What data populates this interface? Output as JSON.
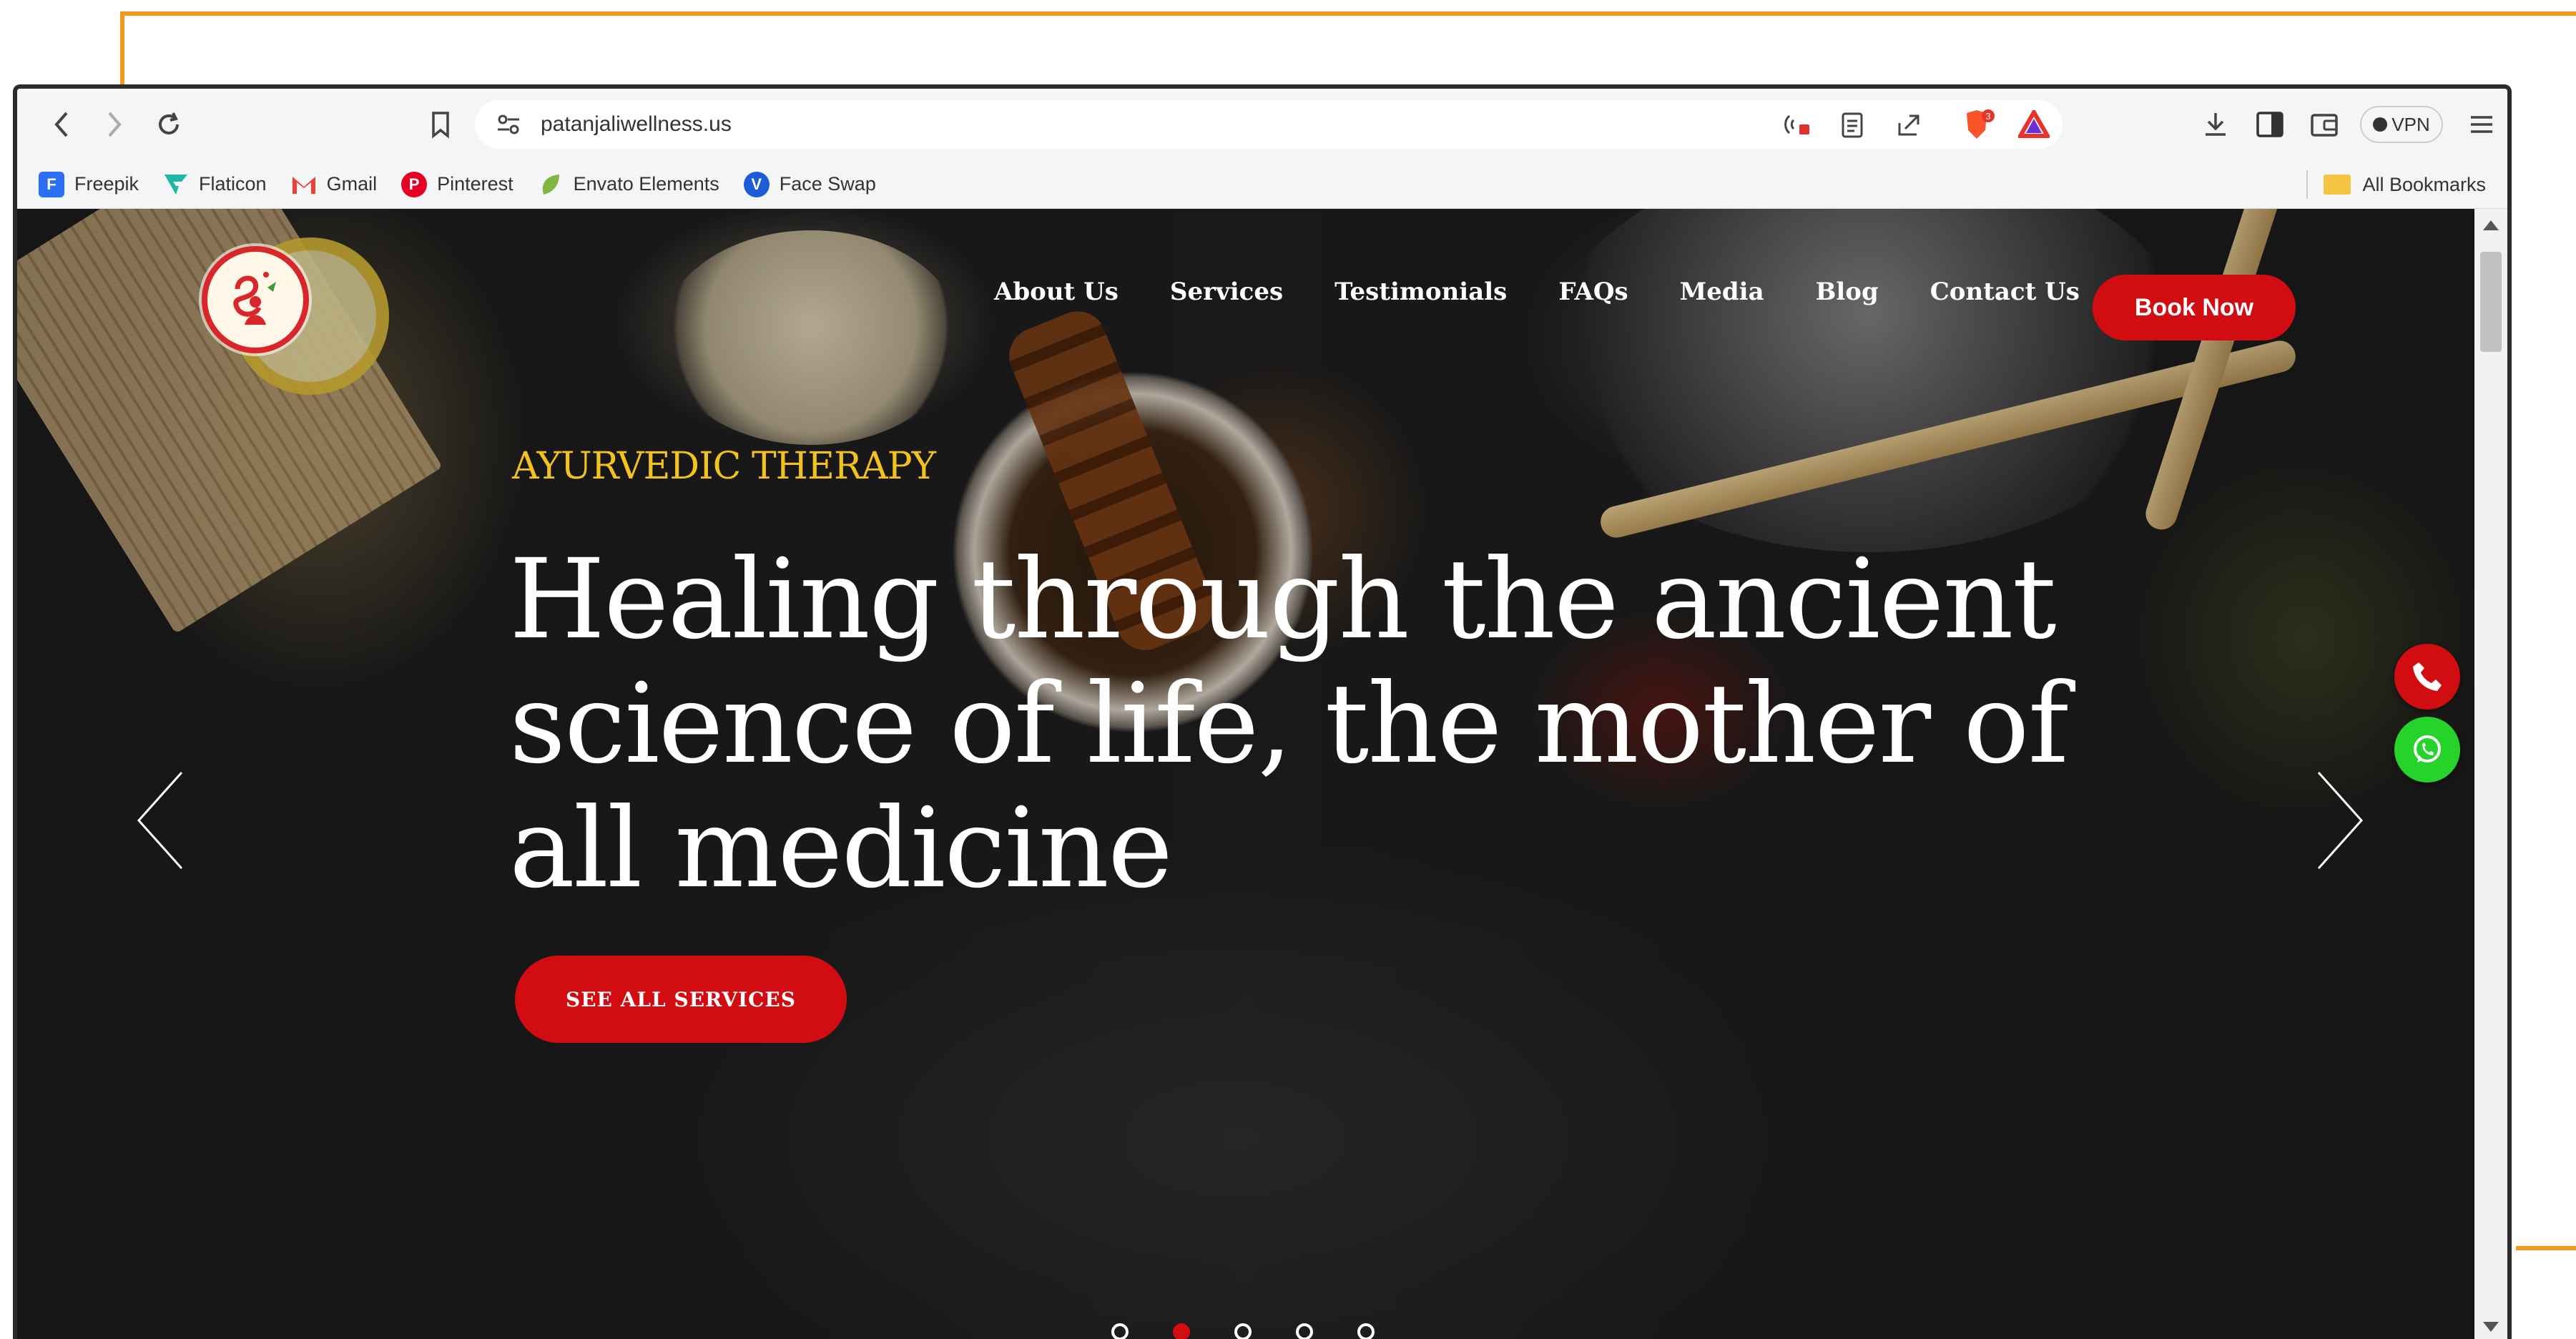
{
  "browser": {
    "url": "patanjaliwellness.us",
    "vpn_label": "VPN",
    "brave_badge": "3",
    "bookmarks": [
      {
        "label": "Freepik",
        "icon": "freepik-icon",
        "color": "#2a6ff3"
      },
      {
        "label": "Flaticon",
        "icon": "flaticon-icon",
        "color": "#1fb7a5"
      },
      {
        "label": "Gmail",
        "icon": "gmail-icon",
        "color": "#ea4335"
      },
      {
        "label": "Pinterest",
        "icon": "pinterest-icon",
        "color": "#e60023"
      },
      {
        "label": "Envato Elements",
        "icon": "envato-icon",
        "color": "#82b541"
      },
      {
        "label": "Face Swap",
        "icon": "faceswap-icon",
        "color": "#1e5bd6"
      }
    ],
    "all_bookmarks_label": "All Bookmarks"
  },
  "site": {
    "nav": [
      "About Us",
      "Services",
      "Testimonials",
      "FAQs",
      "Media",
      "Blog",
      "Contact Us"
    ],
    "book_now": "Book Now",
    "hero": {
      "kicker": "AYURVEDIC THERAPY",
      "headline": "Healing through the ancient science of life, the mother of all medicine",
      "cta": "SEE ALL SERVICES",
      "slides_total": 5,
      "active_slide": 2
    },
    "colors": {
      "accent_red": "#d20d12",
      "kicker_gold": "#f2c21e",
      "whatsapp_green": "#25d32a"
    }
  }
}
